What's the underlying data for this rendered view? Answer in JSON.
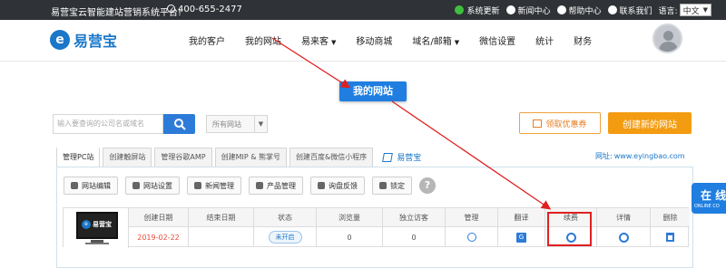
{
  "topbar": {
    "slogan": "易营宝云智能建站营销系统平台!",
    "phone": "400-655-2477",
    "links": [
      {
        "label": "系统更新",
        "icon": "refresh-icon",
        "color": "#3fbf3f"
      },
      {
        "label": "新闻中心",
        "icon": "news-icon",
        "color": "#ffffff"
      },
      {
        "label": "帮助中心",
        "icon": "help-icon",
        "color": "#ffffff"
      },
      {
        "label": "联系我们",
        "icon": "contact-icon",
        "color": "#ffffff"
      }
    ],
    "language_label": "语言:",
    "language_value": "中文"
  },
  "header": {
    "logo_text": "易营宝",
    "logo_mark": "e",
    "nav": [
      {
        "label": "我的客户",
        "dropdown": false
      },
      {
        "label": "我的网站",
        "dropdown": false,
        "active": true
      },
      {
        "label": "易来客",
        "dropdown": true
      },
      {
        "label": "移动商城",
        "dropdown": false
      },
      {
        "label": "域名/邮箱",
        "dropdown": true
      },
      {
        "label": "微信设置",
        "dropdown": false
      },
      {
        "label": "统计",
        "dropdown": false
      },
      {
        "label": "财务",
        "dropdown": false
      }
    ]
  },
  "callout": "我的网站",
  "search": {
    "placeholder": "输入要查询的公司名或域名",
    "site_filter": "所有网站"
  },
  "buttons": {
    "coupon": "领取优惠券",
    "create_site": "创建新的网站"
  },
  "tabs": [
    "管理PC站",
    "创建触屏站",
    "管理谷歌AMP",
    "创建MIP & 熊掌号",
    "创建百度&微信小程序"
  ],
  "brand_link": "易营宝",
  "site_url_label": "网址:",
  "site_url": "www.eyingbao.com",
  "toolbar": [
    "网站编辑",
    "网站设置",
    "新闻管理",
    "产品管理",
    "询盘反馈",
    "锁定"
  ],
  "table": {
    "thumbnail_text": "易营宝",
    "headers": [
      "创建日期",
      "结束日期",
      "状态",
      "浏览量",
      "独立访客",
      "管理",
      "翻译",
      "续费",
      "详情",
      "删除"
    ],
    "row": {
      "created": "2019-02-22",
      "ended": "",
      "status": "未开启",
      "views": "0",
      "visitors": "0"
    }
  },
  "online_service": {
    "title": "在 线",
    "subtitle": "ONLINE CO"
  },
  "colors": {
    "accent": "#1a77c9",
    "topbar_bg": "#2f3236",
    "orange": "#f39c12",
    "highlight": "#e02020"
  }
}
